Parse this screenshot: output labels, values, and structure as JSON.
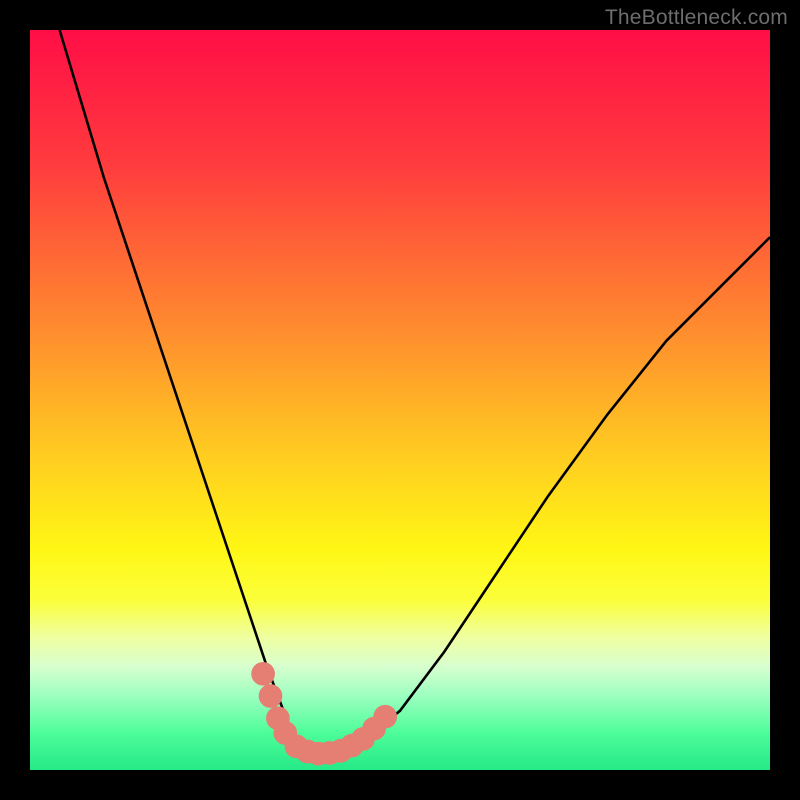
{
  "watermark": "TheBottleneck.com",
  "chart_data": {
    "type": "line",
    "title": "",
    "xlabel": "",
    "ylabel": "",
    "xlim": [
      0,
      100
    ],
    "ylim": [
      0,
      100
    ],
    "gradient_stops": [
      {
        "offset": 0,
        "color": "#ff0e46"
      },
      {
        "offset": 18,
        "color": "#ff3b3e"
      },
      {
        "offset": 40,
        "color": "#ff8a2f"
      },
      {
        "offset": 58,
        "color": "#ffce20"
      },
      {
        "offset": 70,
        "color": "#fff615"
      },
      {
        "offset": 77,
        "color": "#fbff3a"
      },
      {
        "offset": 82,
        "color": "#f0ffa0"
      },
      {
        "offset": 86,
        "color": "#d7ffce"
      },
      {
        "offset": 90,
        "color": "#9cffc0"
      },
      {
        "offset": 95,
        "color": "#4dfd99"
      },
      {
        "offset": 100,
        "color": "#25e987"
      }
    ],
    "series": [
      {
        "name": "bottleneck-curve",
        "color": "#000000",
        "x": [
          4,
          7,
          10,
          14,
          18,
          22,
          25,
          28,
          30,
          32,
          33.5,
          35,
          36.5,
          38,
          40,
          42,
          45,
          50,
          56,
          62,
          70,
          78,
          86,
          94,
          100
        ],
        "y": [
          100,
          90,
          80,
          68,
          56,
          44,
          35,
          26,
          20,
          14,
          10,
          6,
          3.5,
          2.5,
          2.2,
          2.5,
          4,
          8,
          16,
          25,
          37,
          48,
          58,
          66,
          72
        ]
      }
    ],
    "markers": {
      "color": "#e57e73",
      "radius": 1.6,
      "points": [
        {
          "x": 31.5,
          "y": 13
        },
        {
          "x": 32.5,
          "y": 10
        },
        {
          "x": 33.5,
          "y": 7
        },
        {
          "x": 34.5,
          "y": 5
        },
        {
          "x": 36,
          "y": 3.2
        },
        {
          "x": 37.5,
          "y": 2.5
        },
        {
          "x": 39,
          "y": 2.2
        },
        {
          "x": 40.5,
          "y": 2.3
        },
        {
          "x": 42,
          "y": 2.6
        },
        {
          "x": 43.5,
          "y": 3.3
        },
        {
          "x": 45,
          "y": 4.2
        },
        {
          "x": 46.5,
          "y": 5.6
        },
        {
          "x": 48,
          "y": 7.2
        }
      ]
    }
  }
}
